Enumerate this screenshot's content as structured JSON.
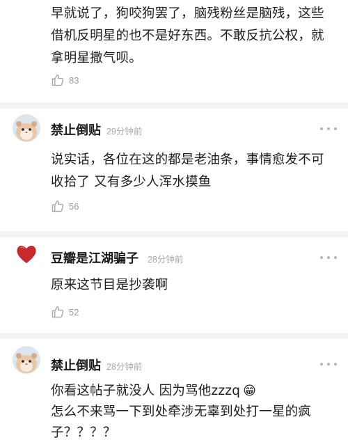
{
  "comments": [
    {
      "text_lines": [
        "早就说了，狗咬狗罢了，脑残粉丝是脑残，这些",
        "借机反明星的也不是好东西。不敢反抗公权，就",
        "拿明星撒气呗。"
      ],
      "likes": "83"
    },
    {
      "author": "禁止倒贴",
      "time": "29分钟前",
      "text_lines": [
        "说实话，各位在这的都是老油条，事情愈发不可",
        "收拾了 又有多少人浑水摸鱼"
      ],
      "likes": "56"
    },
    {
      "author": "豆瓣是江湖骗子",
      "time": "28分钟前",
      "text_lines": [
        "原来这节目是抄袭啊"
      ],
      "likes": "52"
    },
    {
      "author": "禁止倒贴",
      "time": "28分钟前",
      "text_lines": [
        "你看这帖子就没人 因为骂他zzzq",
        "怎么不来骂一下到处牵涉无辜到处打一星的疯",
        "子？？？？"
      ],
      "emoji": "😁"
    }
  ],
  "colors": {
    "like_gray": "#9a9a9a",
    "divider": "#f3f3f3",
    "heart_red": "#c62a2a"
  },
  "icons": [
    "thumbs-up-icon",
    "more-dots-icon",
    "hamster-avatar",
    "heart-avatar",
    "grin-emoji"
  ]
}
